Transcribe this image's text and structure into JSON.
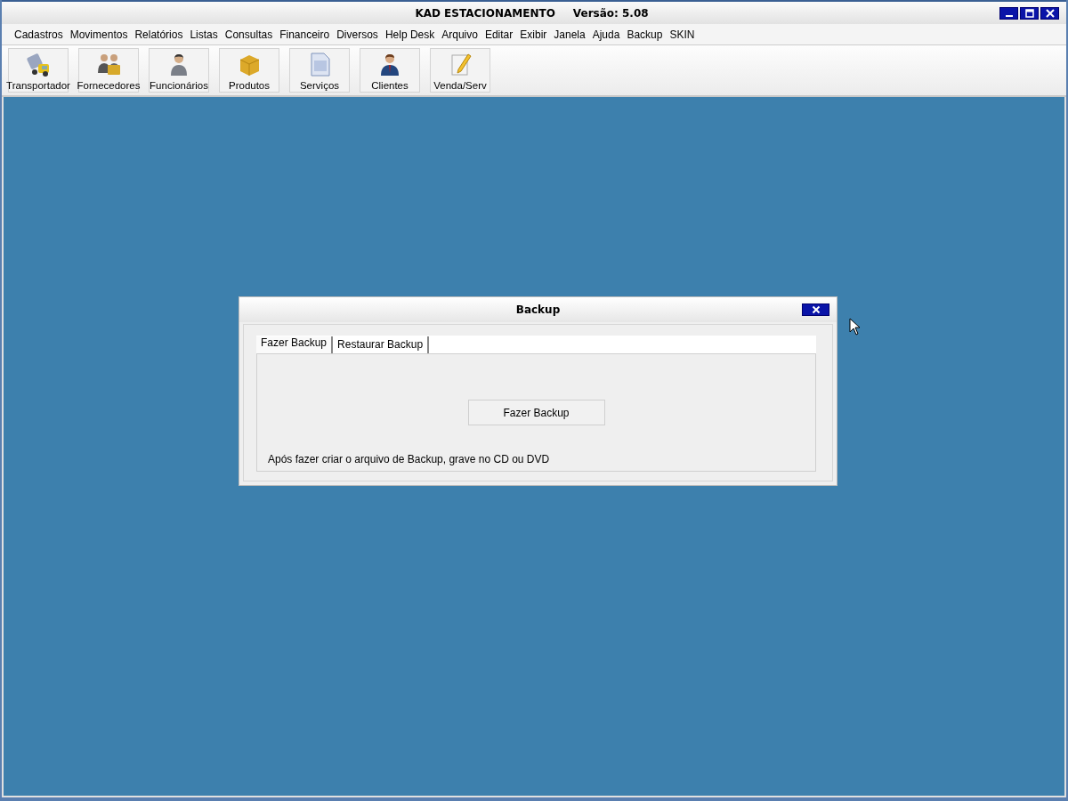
{
  "window": {
    "title": "KAD ESTACIONAMENTO",
    "version": "Versão: 5.08"
  },
  "menu": [
    "Cadastros",
    "Movimentos",
    "Relatórios",
    "Listas",
    "Consultas",
    "Financeiro",
    "Diversos",
    "Help Desk",
    "Arquivo",
    "Editar",
    "Exibir",
    "Janela",
    "Ajuda",
    "Backup",
    "SKIN"
  ],
  "toolbar": [
    "Transportador",
    "Fornecedores",
    "Funcionários",
    "Produtos",
    "Serviços",
    "Clientes",
    "Venda/Serv"
  ],
  "dialog": {
    "title": "Backup",
    "tabs": [
      {
        "label": "Fazer Backup",
        "selected": true
      },
      {
        "label": "Restaurar Backup",
        "selected": false
      }
    ],
    "button": "Fazer Backup",
    "note": "Após fazer criar o arquivo de Backup, grave no CD ou DVD"
  }
}
